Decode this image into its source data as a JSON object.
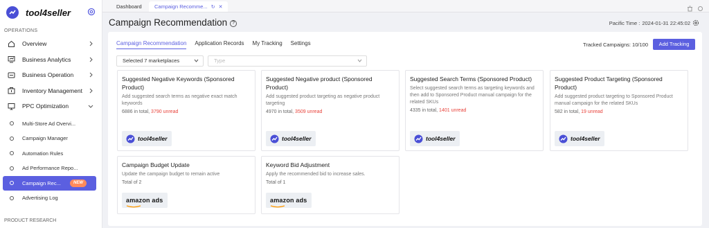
{
  "app": {
    "name": "tool4seller"
  },
  "sidebar": {
    "section_ops": "OPERATIONS",
    "section_research": "PRODUCT RESEARCH",
    "items": [
      {
        "label": "Overview",
        "icon": "home-icon"
      },
      {
        "label": "Business Analytics",
        "icon": "analytics-icon"
      },
      {
        "label": "Business Operation",
        "icon": "operation-icon"
      },
      {
        "label": "Inventory Management",
        "icon": "inventory-icon"
      },
      {
        "label": "PPC Optimization",
        "icon": "monitor-icon"
      }
    ],
    "sub_items": [
      {
        "label": "Multi-Store Ad Overvi..."
      },
      {
        "label": "Campaign Manager"
      },
      {
        "label": "Automation Rules"
      },
      {
        "label": "Ad Performance Repo..."
      },
      {
        "label": "Campaign Rec...",
        "badge": "NEW",
        "active": true
      },
      {
        "label": "Advertising Log"
      }
    ]
  },
  "tabs": {
    "dashboard": "Dashboard",
    "active": "Campaign Recomme..."
  },
  "header": {
    "title": "Campaign Recommendation",
    "time_label": "Pacific Time :",
    "time_value": "2024-01-31 22:45:02"
  },
  "main": {
    "subtabs": [
      "Campaign Recommendation",
      "Application Records",
      "My Tracking",
      "Settings"
    ],
    "tracked": "Tracked Campaigns: 10/100",
    "add_button": "Add Tracking",
    "marketplace_select": "Selected 7 marketplaces",
    "type_placeholder": "Type"
  },
  "cards": [
    {
      "title": "Suggested Negative Keywords (Sponsored Product)",
      "desc": "Add suggested search terms as negative exact match keywords",
      "total": "6886 in total,",
      "unread": "3790 unread",
      "brand": "tool4seller"
    },
    {
      "title": "Suggested Negative product (Sponsored Product)",
      "desc": "Add suggested product targeting as negative product targeting",
      "total": "4970 in total,",
      "unread": "3509 unread",
      "brand": "tool4seller"
    },
    {
      "title": "Suggested Search Terms (Sponsored Product)",
      "desc": "Select suggested search terms as targeting keywords and then add to Sponsored Product manual campaign for the related SKUs",
      "total": "4335 in total,",
      "unread": "1401 unread",
      "brand": "tool4seller"
    },
    {
      "title": "Suggested Product Targeting (Sponsored Product)",
      "desc": "Add suggested product targeting to Sponsored Product manual campaign for the related SKUs",
      "total": "582 in total,",
      "unread": "19 unread",
      "brand": "tool4seller"
    },
    {
      "title": "Campaign Budget Update",
      "desc": "Update the campaign budget to remain active",
      "total": "Total of 2",
      "brand": "amazon ads"
    },
    {
      "title": "Keyword Bid Adjustment",
      "desc": "Apply the recommended bid to increase sales.",
      "total": "Total of 1",
      "brand": "amazon ads"
    }
  ],
  "colors": {
    "accent": "#5b5fe0",
    "unread": "#e8423a",
    "badge": "#ff8a5b"
  }
}
